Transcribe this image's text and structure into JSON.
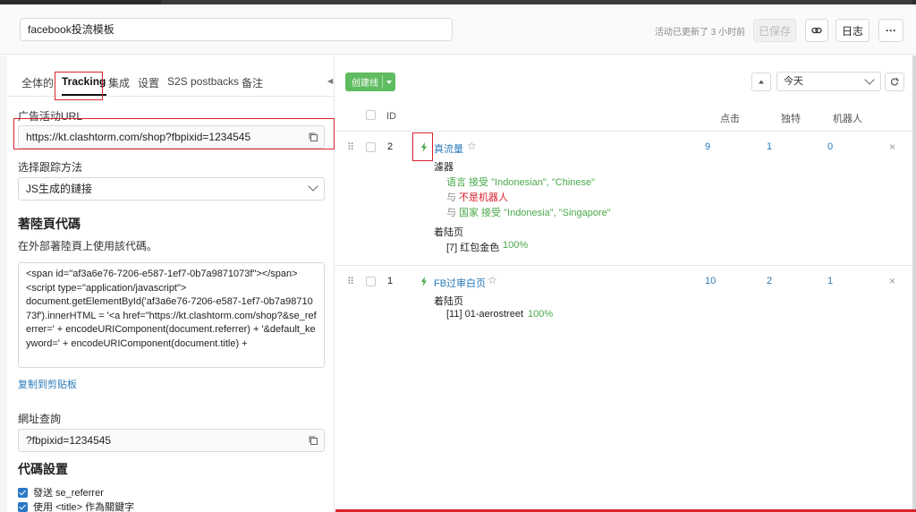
{
  "header": {
    "title_value": "facebook投流模板",
    "updated_text": "活动已更新了 3 小时前",
    "saved_label": "已保存",
    "log_label": "日志",
    "more_label": "···"
  },
  "tabs": [
    {
      "label": "全体的"
    },
    {
      "label": "Tracking"
    },
    {
      "label": "集成"
    },
    {
      "label": "设置"
    },
    {
      "label": "S2S postbacks"
    },
    {
      "label": "备注"
    }
  ],
  "left": {
    "campaign_url_label": "广告活动URL",
    "campaign_url": "https://kt.clashtorm.com/shop?fbpixid=1234545",
    "tracking_method_label": "选择跟踪方法",
    "tracking_method": "JS生成的鏈接",
    "landing_code_title": "著陸頁代碼",
    "landing_code_desc": "在外部著陸頁上使用該代碼。",
    "code": "<span id=\"af3a6e76-7206-e587-1ef7-0b7a9871073f\"></span>\n<script type=\"application/javascript\">\ndocument.getElementById('af3a6e76-7206-e587-1ef7-0b7a9871073f').innerHTML = '<a href=\"https://kt.clashtorm.com/shop?&se_referrer=' + encodeURIComponent(document.referrer) + '&default_keyword=' + encodeURIComponent(document.title) +",
    "copy_clipboard": "复制到剪贴板",
    "query_label": "網址查詢",
    "query_value": "?fbpixid=1234545",
    "code_settings_title": "代碼設置",
    "checkbox1": "發送 se_referrer",
    "checkbox2": "使用 <title> 作為關鍵字"
  },
  "right": {
    "create_label": "创建线",
    "date_range": "今天",
    "columns": {
      "id": "ID",
      "clicks": "点击",
      "unique": "独特",
      "bots": "机器人"
    },
    "rows": [
      {
        "id": "2",
        "name": "真流量",
        "clicks": "9",
        "unique": "1",
        "bots": "0",
        "filter_title": "濾器",
        "filters": [
          {
            "prefix": "",
            "text": "语言 接受 \"Indonesian\", \"Chinese\""
          },
          {
            "prefix": "与",
            "text": "不是机器人"
          },
          {
            "prefix": "与",
            "text": "国家 接受 \"Indonesia\", \"Singapore\""
          }
        ],
        "landing_title": "着陆页",
        "landing_item": "[7] 红包金色",
        "landing_pct": "100%"
      },
      {
        "id": "1",
        "name": "FB过审白页",
        "clicks": "10",
        "unique": "2",
        "bots": "1",
        "landing_title": "着陆页",
        "landing_item": "[11] 01-aerostreet",
        "landing_pct": "100%"
      }
    ]
  },
  "colors": {
    "accent_green": "#5fbb5f",
    "link_blue": "#2a7ab8",
    "highlight_red": "#d9232d"
  }
}
